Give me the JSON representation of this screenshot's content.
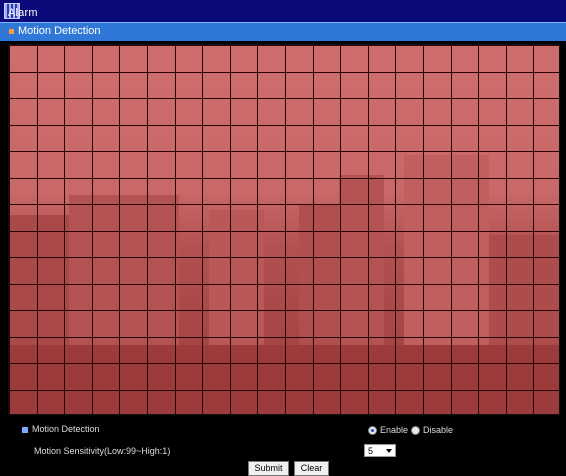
{
  "window": {
    "title": "Alarm"
  },
  "section": {
    "title": "Motion Detection"
  },
  "grid": {
    "columns": 20,
    "rows": 14,
    "overlay_color": "#e23c3c"
  },
  "controls": {
    "motion_detection_label": "Motion Detection",
    "enable_label": "Enable",
    "disable_label": "Disable",
    "enable_selected": true,
    "sensitivity_label": "Motion Sensitivity(Low:99~High:1)",
    "sensitivity_value": "5"
  },
  "buttons": {
    "submit": "Submit",
    "clear": "Clear"
  }
}
